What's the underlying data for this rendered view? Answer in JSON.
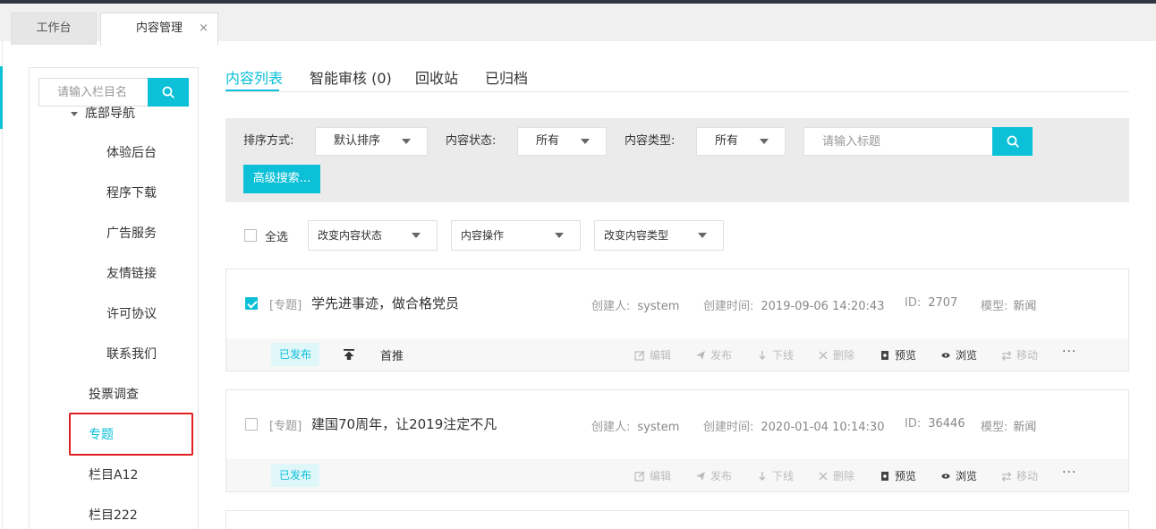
{
  "tabs": [
    {
      "label": "工作台"
    },
    {
      "label": "内容管理",
      "close": "×"
    }
  ],
  "sidebar": {
    "search_placeholder": "请输入栏目名",
    "parent_label": "底部导航",
    "children": [
      "体验后台",
      "程序下载",
      "广告服务",
      "友情链接",
      "许可协议",
      "联系我们"
    ],
    "items": [
      "投票调查",
      "专题",
      "栏目A12",
      "栏目222"
    ],
    "active_item": "专题"
  },
  "subtabs": [
    "内容列表",
    "智能审核 (0)",
    "回收站",
    "已归档"
  ],
  "filters": {
    "sort_label": "排序方式:",
    "sort_value": "默认排序",
    "status_label": "内容状态:",
    "status_value": "所有",
    "type_label": "内容类型:",
    "type_value": "所有",
    "title_placeholder": "请输入标题",
    "advanced_label": "高级搜索..."
  },
  "batch": {
    "select_all": "全选",
    "change_status": "改变内容状态",
    "content_ops": "内容操作",
    "change_type": "改变内容类型"
  },
  "articles": [
    {
      "checked": true,
      "tag": "[专题]",
      "title": "学先进事迹，做合格党员",
      "creator_label": "创建人:",
      "creator": "system",
      "time_label": "创建时间:",
      "time": "2019-09-06 14:20:43",
      "id_label": "ID:",
      "id": "2707",
      "model_label": "模型:",
      "model": "新闻",
      "status": "已发布",
      "pin_label": "首推"
    },
    {
      "checked": false,
      "tag": "[专题]",
      "title": "建国70周年，让2019注定不凡",
      "creator_label": "创建人:",
      "creator": "system",
      "time_label": "创建时间:",
      "time": "2020-01-04 10:14:30",
      "id_label": "ID:",
      "id": "36446",
      "model_label": "模型:",
      "model": "新闻",
      "status": "已发布"
    }
  ],
  "actions": {
    "edit": "编辑",
    "publish": "发布",
    "offline": "下线",
    "delete": "删除",
    "preview": "预览",
    "browse": "浏览",
    "move": "移动",
    "more": "···"
  },
  "colors": {
    "accent": "#0bc0d7",
    "highlight": "#e02020"
  }
}
